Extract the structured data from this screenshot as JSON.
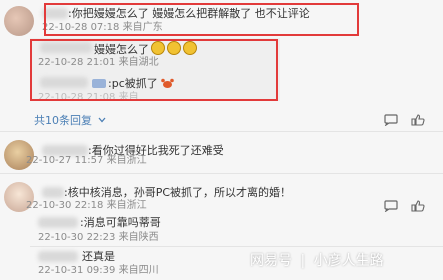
{
  "comment1": {
    "text": ":你把嫚嫚怎么了 嫚嫚怎么把群解散了     也不让评论",
    "meta": "22-10-28 07:18 来自广东"
  },
  "reply1": {
    "text": "嫚嫚怎么了",
    "meta": "22-10-28 21:01 来自湖北"
  },
  "reply2": {
    "text": ":pc被抓了",
    "meta": "22-10-28 21:08 来自"
  },
  "more_replies": "共10条回复",
  "comment2": {
    "text": ":看你过得好比我死了还难受",
    "meta": "22-10-27 11:57 来自浙江"
  },
  "comment3": {
    "text": ":核中核消息，孙哥PC被抓了，所以才离的婚！",
    "meta": "22-10-30 22:18 来自浙江"
  },
  "comment4": {
    "text": ":消息可靠吗蒂哥",
    "meta": "22-10-30 22:23 来自陕西"
  },
  "comment5": {
    "text": "还真是",
    "meta": "22-10-31 09:39 来自四川"
  },
  "watermark": {
    "brand": "网易号",
    "separator": "|",
    "author": "小彦人生路"
  },
  "icons": [
    "chat-bubble-icon",
    "thumbs-up-icon",
    "crab-emoji-icon",
    "chevron-down-icon"
  ]
}
